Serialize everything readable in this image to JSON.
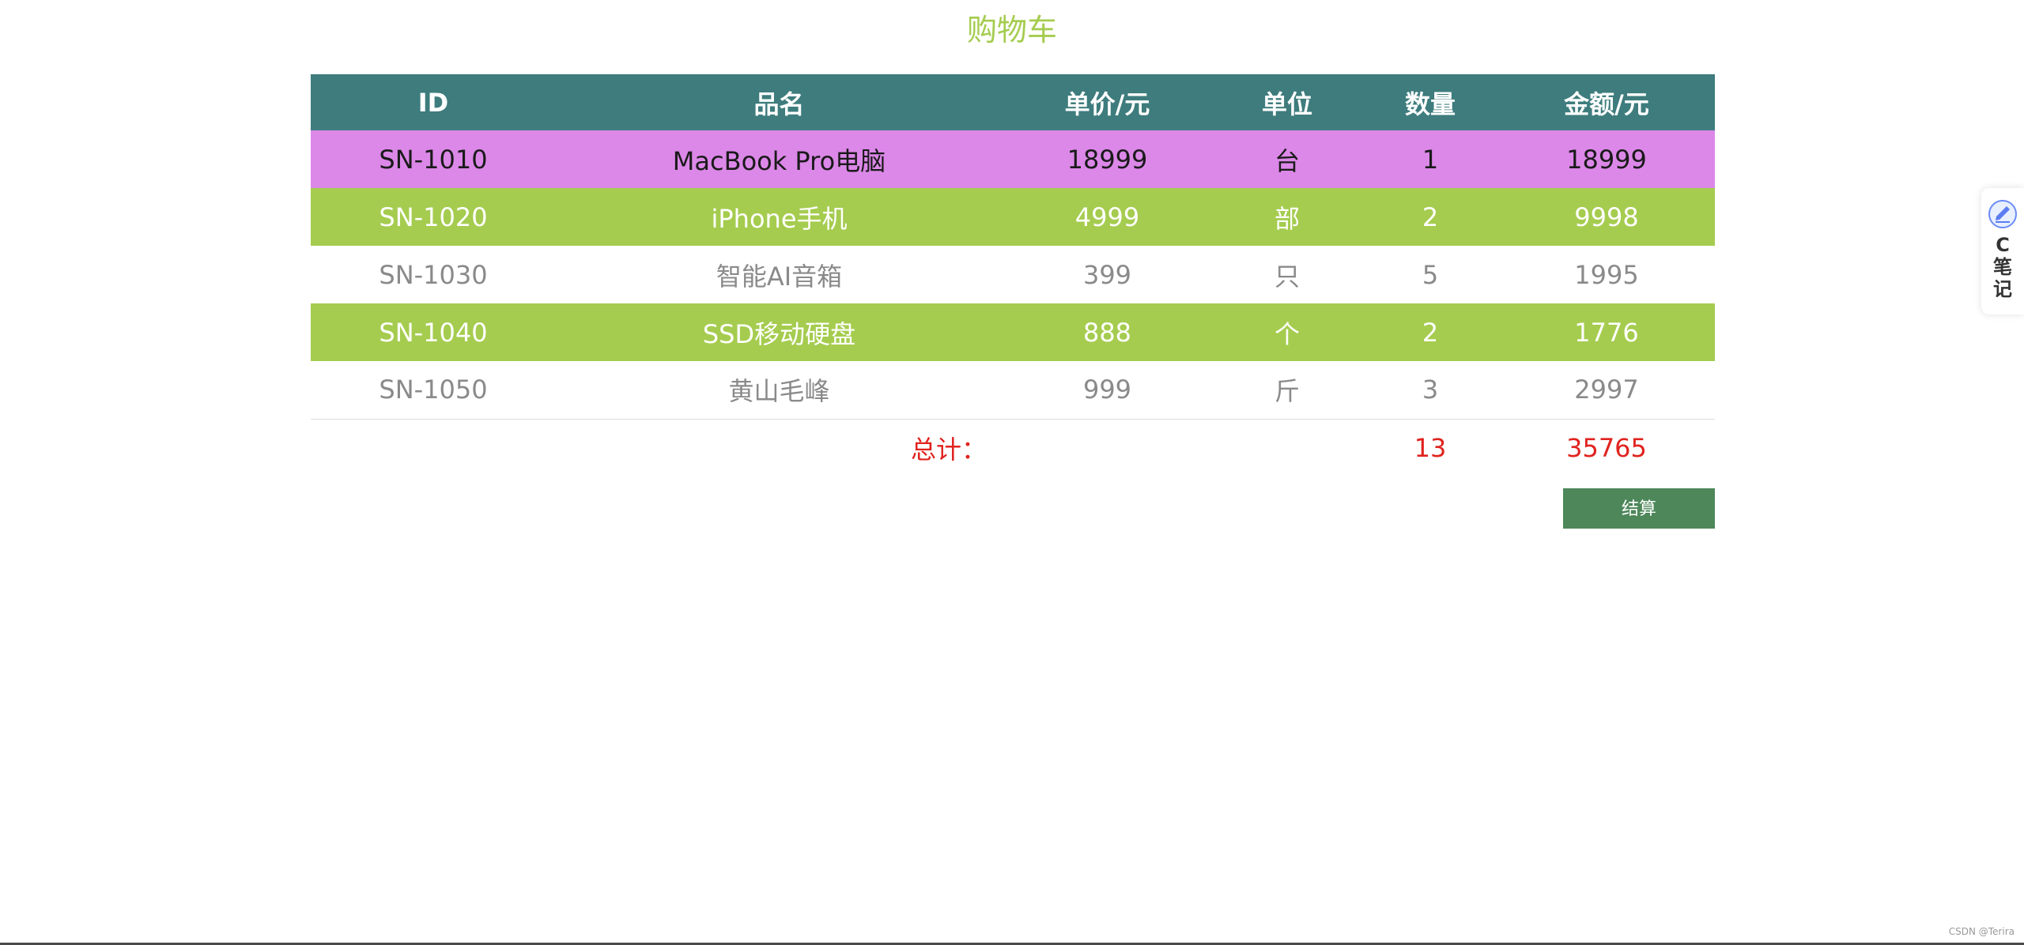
{
  "page": {
    "title": "购物车"
  },
  "table": {
    "headers": [
      "ID",
      "品名",
      "单价/元",
      "单位",
      "数量",
      "金额/元"
    ],
    "rows": [
      {
        "id": "SN-1010",
        "name": "MacBook Pro电脑",
        "price": "18999",
        "unit": "台",
        "qty": "1",
        "amount": "18999",
        "style": "pink"
      },
      {
        "id": "SN-1020",
        "name": "iPhone手机",
        "price": "4999",
        "unit": "部",
        "qty": "2",
        "amount": "9998",
        "style": "green"
      },
      {
        "id": "SN-1030",
        "name": "智能AI音箱",
        "price": "399",
        "unit": "只",
        "qty": "5",
        "amount": "1995",
        "style": "white"
      },
      {
        "id": "SN-1040",
        "name": "SSD移动硬盘",
        "price": "888",
        "unit": "个",
        "qty": "2",
        "amount": "1776",
        "style": "green"
      },
      {
        "id": "SN-1050",
        "name": "黄山毛峰",
        "price": "999",
        "unit": "斤",
        "qty": "3",
        "amount": "2997",
        "style": "white"
      }
    ],
    "total": {
      "label": "总计：",
      "qty": "13",
      "amount": "35765"
    }
  },
  "checkout": {
    "label": "结算"
  },
  "side_widget": {
    "text": "C笔记",
    "icon": "note-icon"
  },
  "watermark": "CSDN @Terira",
  "colors": {
    "title": "#a5cc4f",
    "header_bg": "#3e7c7d",
    "row_pink": "#dc88e8",
    "row_green": "#a5cc4f",
    "total_text": "#e0231f",
    "checkout_bg": "#4d875a"
  }
}
